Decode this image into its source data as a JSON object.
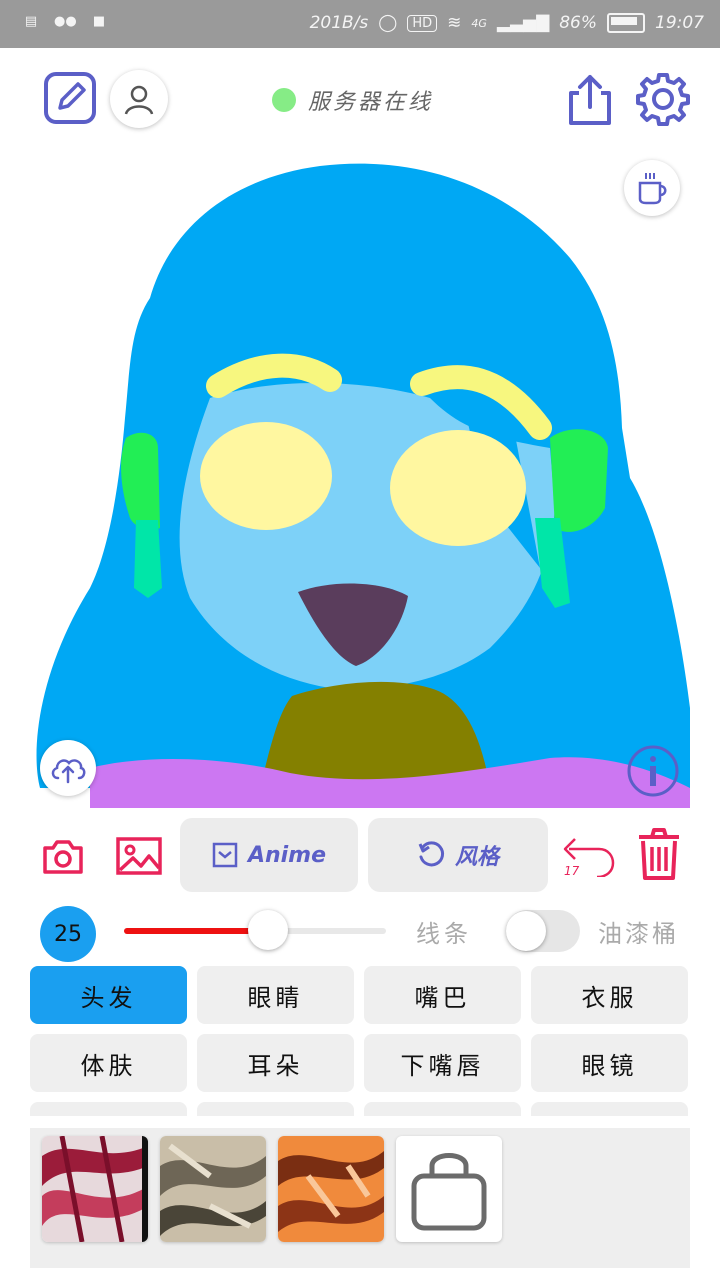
{
  "status_bar": {
    "speed": "201B/s",
    "network": "4G",
    "battery": "86%",
    "time": "19:07",
    "hd": "HD"
  },
  "header": {
    "server_status": "服务器在线",
    "server_status_color": "#86ec86"
  },
  "icons": {
    "edit": "edit-icon",
    "profile": "user-icon",
    "share": "share-icon",
    "settings": "gear-icon",
    "coffee": "coffee-icon",
    "upload": "cloud-upload-icon",
    "info": "info-icon",
    "camera": "camera-icon",
    "gallery": "image-icon",
    "undo": "undo-icon",
    "trash": "trash-icon",
    "shop": "shopping-bag-icon"
  },
  "tools": {
    "anime_label": "Anime",
    "style_label": "风格",
    "undo_count": "17"
  },
  "brush": {
    "size": "25",
    "size_level": 0.55,
    "line_label": "线条",
    "bucket_label": "油漆桶",
    "bucket_enabled": false
  },
  "parts": [
    {
      "label": "头发",
      "active": true
    },
    {
      "label": "眼睛",
      "active": false
    },
    {
      "label": "嘴巴",
      "active": false
    },
    {
      "label": "衣服",
      "active": false
    },
    {
      "label": "体肤",
      "active": false
    },
    {
      "label": "耳朵",
      "active": false
    },
    {
      "label": "下嘴唇",
      "active": false
    },
    {
      "label": "眼镜",
      "active": false
    }
  ],
  "colors": {
    "accent_purple": "#5b5fc7",
    "accent_red": "#e8245a",
    "accent_blue": "#1a9ff0"
  }
}
